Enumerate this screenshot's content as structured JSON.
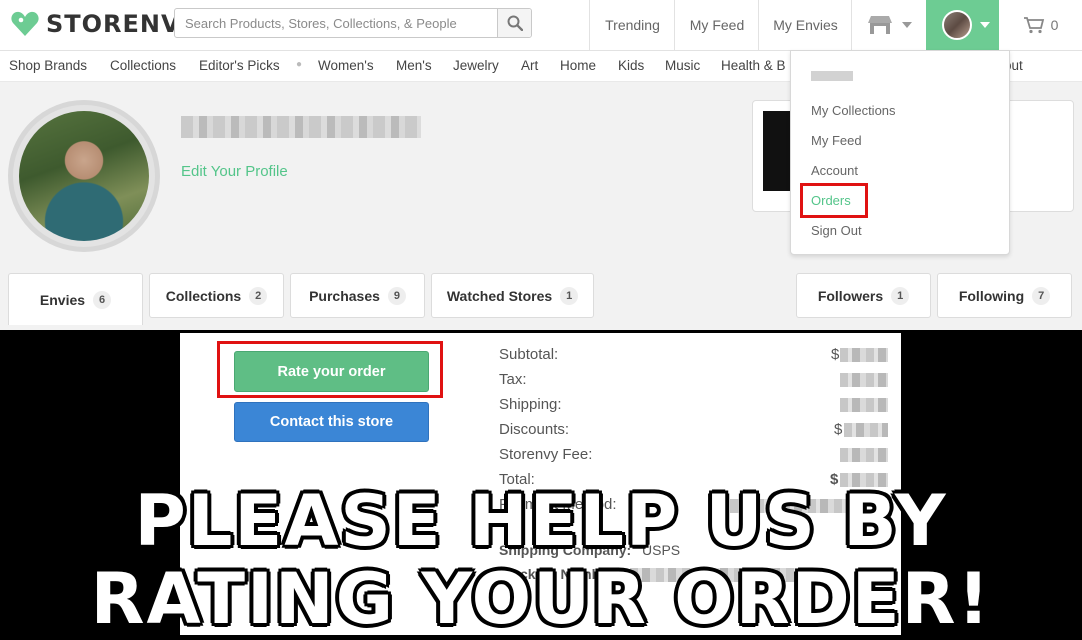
{
  "header": {
    "logo_text": "STORENVY",
    "search_placeholder": "Search Products, Stores, Collections, & People",
    "nav": [
      "Trending",
      "My Feed",
      "My Envies"
    ],
    "cart_count": "0"
  },
  "categories": [
    "Shop Brands",
    "Collections",
    "Editor's Picks",
    "Women's",
    "Men's",
    "Jewelry",
    "Art",
    "Home",
    "Kids",
    "Music",
    "Health & B",
    "out"
  ],
  "profile": {
    "edit_link": "Edit Your Profile"
  },
  "tabs": [
    {
      "label": "Envies",
      "count": "6"
    },
    {
      "label": "Collections",
      "count": "2"
    },
    {
      "label": "Purchases",
      "count": "9"
    },
    {
      "label": "Watched Stores",
      "count": "1"
    },
    {
      "label": "Followers",
      "count": "1"
    },
    {
      "label": "Following",
      "count": "7"
    }
  ],
  "dropdown": {
    "items": [
      "My Collections",
      "My Feed",
      "Account",
      "Orders",
      "Sign Out"
    ]
  },
  "order": {
    "rate_button": "Rate your order",
    "contact_button": "Contact this store",
    "labels": [
      "Subtotal:",
      "Tax:",
      "Shipping:",
      "Discounts:",
      "Storenvy Fee:",
      "Total:"
    ],
    "subtotal_prefix": "$",
    "discount_prefix": "$",
    "total_prefix": "$",
    "payment_label": "Payment Method:",
    "shipping_company_label": "Shipping Company:",
    "shipping_company_value": "USPS",
    "tracking_label": "Tracking Number:"
  },
  "overlay": {
    "line1": "PLEASE HELP US BY",
    "line2": "RATING YOUR ORDER!"
  },
  "colors": {
    "brand_green": "#6dcc93",
    "button_green": "#5fbe85",
    "button_blue": "#3b86d6",
    "highlight_red": "#e01212"
  }
}
